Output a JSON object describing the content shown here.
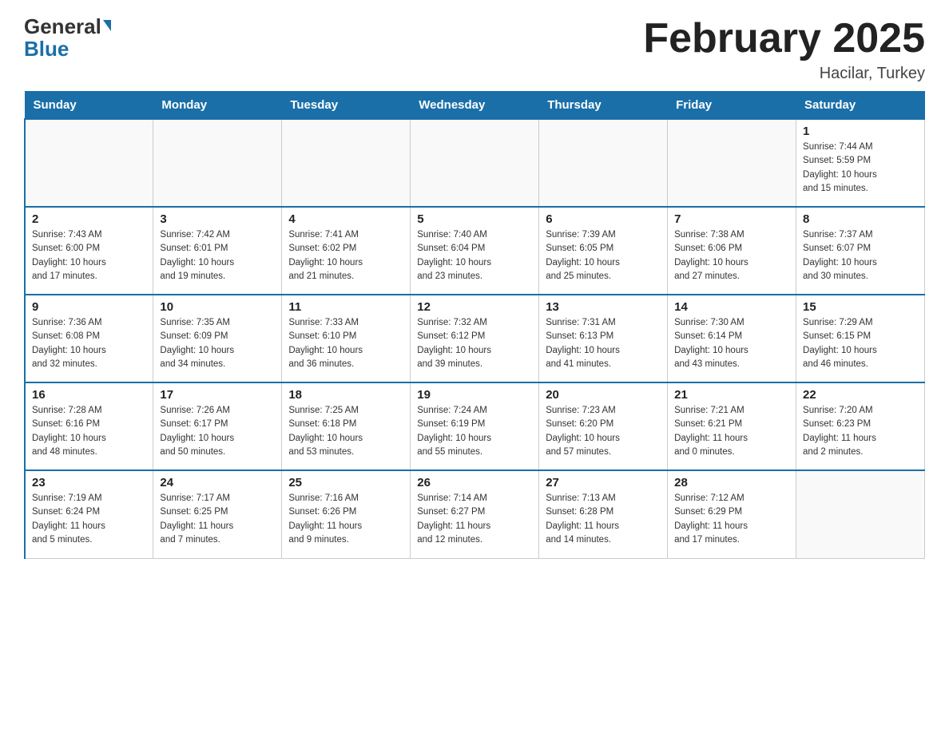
{
  "header": {
    "logo_general": "General",
    "logo_blue": "Blue",
    "month_title": "February 2025",
    "location": "Hacilar, Turkey"
  },
  "days_of_week": [
    "Sunday",
    "Monday",
    "Tuesday",
    "Wednesday",
    "Thursday",
    "Friday",
    "Saturday"
  ],
  "weeks": [
    [
      {
        "day": "",
        "info": ""
      },
      {
        "day": "",
        "info": ""
      },
      {
        "day": "",
        "info": ""
      },
      {
        "day": "",
        "info": ""
      },
      {
        "day": "",
        "info": ""
      },
      {
        "day": "",
        "info": ""
      },
      {
        "day": "1",
        "info": "Sunrise: 7:44 AM\nSunset: 5:59 PM\nDaylight: 10 hours\nand 15 minutes."
      }
    ],
    [
      {
        "day": "2",
        "info": "Sunrise: 7:43 AM\nSunset: 6:00 PM\nDaylight: 10 hours\nand 17 minutes."
      },
      {
        "day": "3",
        "info": "Sunrise: 7:42 AM\nSunset: 6:01 PM\nDaylight: 10 hours\nand 19 minutes."
      },
      {
        "day": "4",
        "info": "Sunrise: 7:41 AM\nSunset: 6:02 PM\nDaylight: 10 hours\nand 21 minutes."
      },
      {
        "day": "5",
        "info": "Sunrise: 7:40 AM\nSunset: 6:04 PM\nDaylight: 10 hours\nand 23 minutes."
      },
      {
        "day": "6",
        "info": "Sunrise: 7:39 AM\nSunset: 6:05 PM\nDaylight: 10 hours\nand 25 minutes."
      },
      {
        "day": "7",
        "info": "Sunrise: 7:38 AM\nSunset: 6:06 PM\nDaylight: 10 hours\nand 27 minutes."
      },
      {
        "day": "8",
        "info": "Sunrise: 7:37 AM\nSunset: 6:07 PM\nDaylight: 10 hours\nand 30 minutes."
      }
    ],
    [
      {
        "day": "9",
        "info": "Sunrise: 7:36 AM\nSunset: 6:08 PM\nDaylight: 10 hours\nand 32 minutes."
      },
      {
        "day": "10",
        "info": "Sunrise: 7:35 AM\nSunset: 6:09 PM\nDaylight: 10 hours\nand 34 minutes."
      },
      {
        "day": "11",
        "info": "Sunrise: 7:33 AM\nSunset: 6:10 PM\nDaylight: 10 hours\nand 36 minutes."
      },
      {
        "day": "12",
        "info": "Sunrise: 7:32 AM\nSunset: 6:12 PM\nDaylight: 10 hours\nand 39 minutes."
      },
      {
        "day": "13",
        "info": "Sunrise: 7:31 AM\nSunset: 6:13 PM\nDaylight: 10 hours\nand 41 minutes."
      },
      {
        "day": "14",
        "info": "Sunrise: 7:30 AM\nSunset: 6:14 PM\nDaylight: 10 hours\nand 43 minutes."
      },
      {
        "day": "15",
        "info": "Sunrise: 7:29 AM\nSunset: 6:15 PM\nDaylight: 10 hours\nand 46 minutes."
      }
    ],
    [
      {
        "day": "16",
        "info": "Sunrise: 7:28 AM\nSunset: 6:16 PM\nDaylight: 10 hours\nand 48 minutes."
      },
      {
        "day": "17",
        "info": "Sunrise: 7:26 AM\nSunset: 6:17 PM\nDaylight: 10 hours\nand 50 minutes."
      },
      {
        "day": "18",
        "info": "Sunrise: 7:25 AM\nSunset: 6:18 PM\nDaylight: 10 hours\nand 53 minutes."
      },
      {
        "day": "19",
        "info": "Sunrise: 7:24 AM\nSunset: 6:19 PM\nDaylight: 10 hours\nand 55 minutes."
      },
      {
        "day": "20",
        "info": "Sunrise: 7:23 AM\nSunset: 6:20 PM\nDaylight: 10 hours\nand 57 minutes."
      },
      {
        "day": "21",
        "info": "Sunrise: 7:21 AM\nSunset: 6:21 PM\nDaylight: 11 hours\nand 0 minutes."
      },
      {
        "day": "22",
        "info": "Sunrise: 7:20 AM\nSunset: 6:23 PM\nDaylight: 11 hours\nand 2 minutes."
      }
    ],
    [
      {
        "day": "23",
        "info": "Sunrise: 7:19 AM\nSunset: 6:24 PM\nDaylight: 11 hours\nand 5 minutes."
      },
      {
        "day": "24",
        "info": "Sunrise: 7:17 AM\nSunset: 6:25 PM\nDaylight: 11 hours\nand 7 minutes."
      },
      {
        "day": "25",
        "info": "Sunrise: 7:16 AM\nSunset: 6:26 PM\nDaylight: 11 hours\nand 9 minutes."
      },
      {
        "day": "26",
        "info": "Sunrise: 7:14 AM\nSunset: 6:27 PM\nDaylight: 11 hours\nand 12 minutes."
      },
      {
        "day": "27",
        "info": "Sunrise: 7:13 AM\nSunset: 6:28 PM\nDaylight: 11 hours\nand 14 minutes."
      },
      {
        "day": "28",
        "info": "Sunrise: 7:12 AM\nSunset: 6:29 PM\nDaylight: 11 hours\nand 17 minutes."
      },
      {
        "day": "",
        "info": ""
      }
    ]
  ]
}
